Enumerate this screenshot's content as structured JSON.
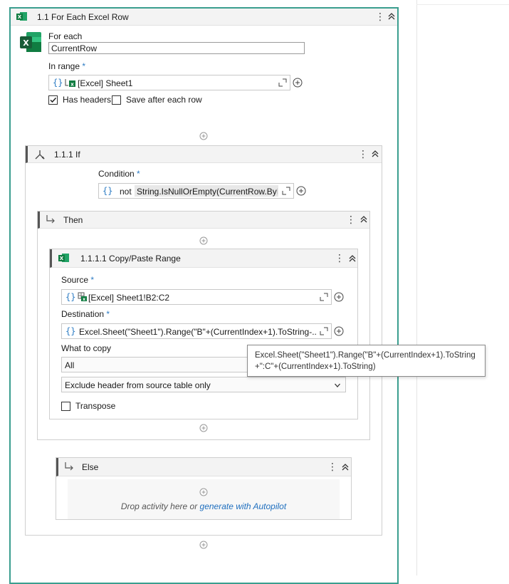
{
  "foreach": {
    "title": "1.1 For Each Excel Row",
    "for_each_label": "For each",
    "for_each_value": "CurrentRow",
    "in_range_label": "In range",
    "in_range_value": "[Excel] Sheet1",
    "has_headers_label": "Has headers",
    "has_headers_checked": true,
    "save_after_label": "Save after each row",
    "save_after_checked": false
  },
  "if_block": {
    "title": "1.1.1 If",
    "condition_label": "Condition",
    "condition_prefix": "not",
    "condition_value": "String.IsNullOrEmpty(CurrentRow.ByI"
  },
  "then_block": {
    "title": "Then"
  },
  "copy_paste": {
    "title": "1.1.1.1 Copy/Paste Range",
    "source_label": "Source",
    "source_value": "[Excel] Sheet1!B2:C2",
    "destination_label": "Destination",
    "destination_value": "Excel.Sheet(\"Sheet1\").Range(\"B\"+(CurrentIndex+1).ToString-...",
    "what_to_copy_label": "What to copy",
    "what_to_copy_value": "All",
    "header_option_value": "Exclude header from source table only",
    "transpose_label": "Transpose",
    "transpose_checked": false
  },
  "tooltip": {
    "line1": "Excel.Sheet(\"Sheet1\").Range(\"B\"+(CurrentIndex+1).ToString",
    "line2": "+\":C\"+(CurrentIndex+1).ToString)"
  },
  "else_block": {
    "title": "Else",
    "drop_text": "Drop activity here or",
    "drop_link": "generate with Autopilot"
  },
  "required_marker": "*",
  "curly_braces": "{}",
  "colors": {
    "accent": "#2d7cc4",
    "outer_border": "#3b9e8f",
    "excel_green": "#1f7244"
  }
}
